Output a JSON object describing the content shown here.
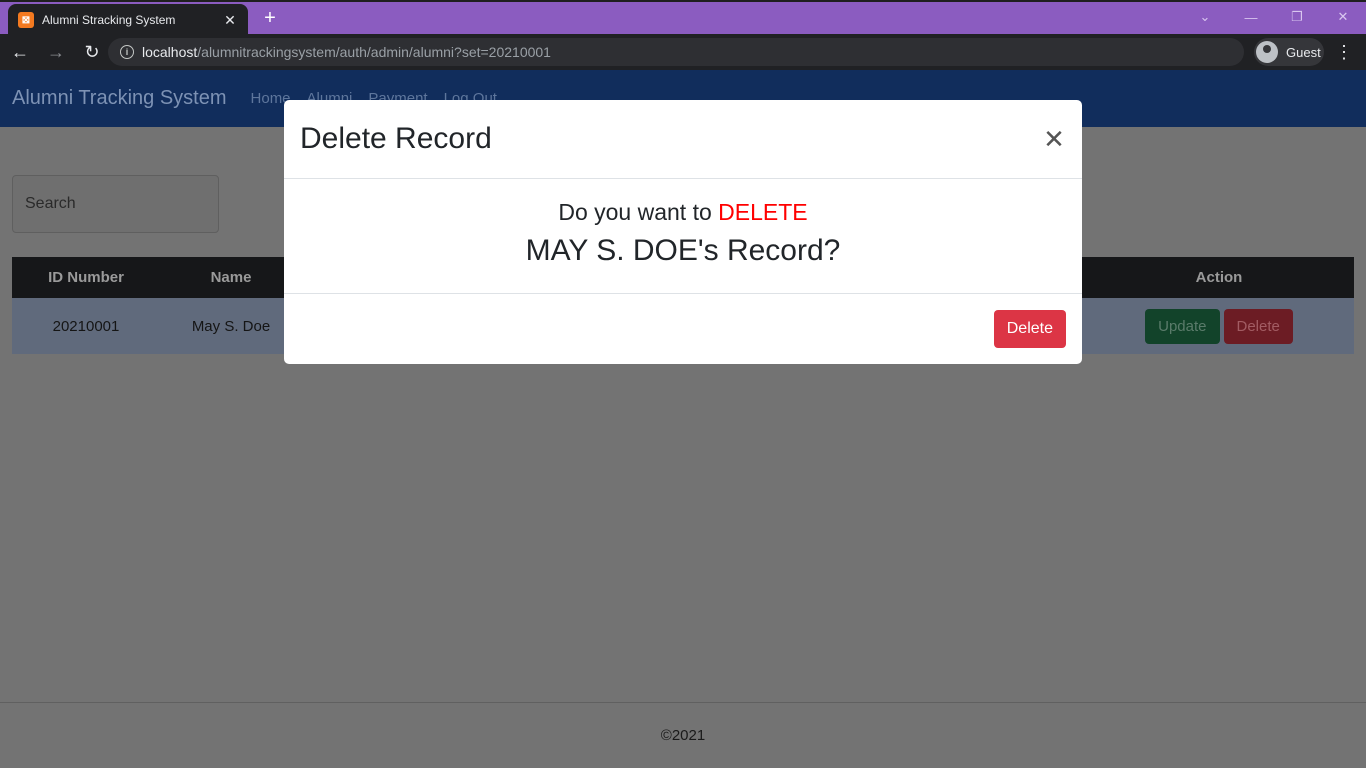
{
  "browser": {
    "tab_title": "Alumni Stracking System",
    "tab_favicon_letter": "⊠",
    "url_host": "localhost",
    "url_path": "/alumnitrackingsystem/auth/admin/alumni?set=20210001",
    "profile_label": "Guest"
  },
  "navbar": {
    "brand": "Alumni Tracking System",
    "links": [
      "Home",
      "Alumni",
      "Payment",
      "Log Out"
    ]
  },
  "search": {
    "placeholder": "Search"
  },
  "table": {
    "headers": [
      "ID Number",
      "Name",
      "Action"
    ],
    "rows": [
      {
        "id": "20210001",
        "name": "May S. Doe",
        "update": "Update",
        "delete": "Delete"
      }
    ]
  },
  "footer": {
    "text": "©2021"
  },
  "modal": {
    "title": "Delete Record",
    "question_prefix": "Do you want to ",
    "question_highlight": "DELETE",
    "record_line": "MAY S. DOE's Record?",
    "delete_label": "Delete",
    "highlight_color": "#ff0000",
    "button_color": "#dc3545"
  }
}
